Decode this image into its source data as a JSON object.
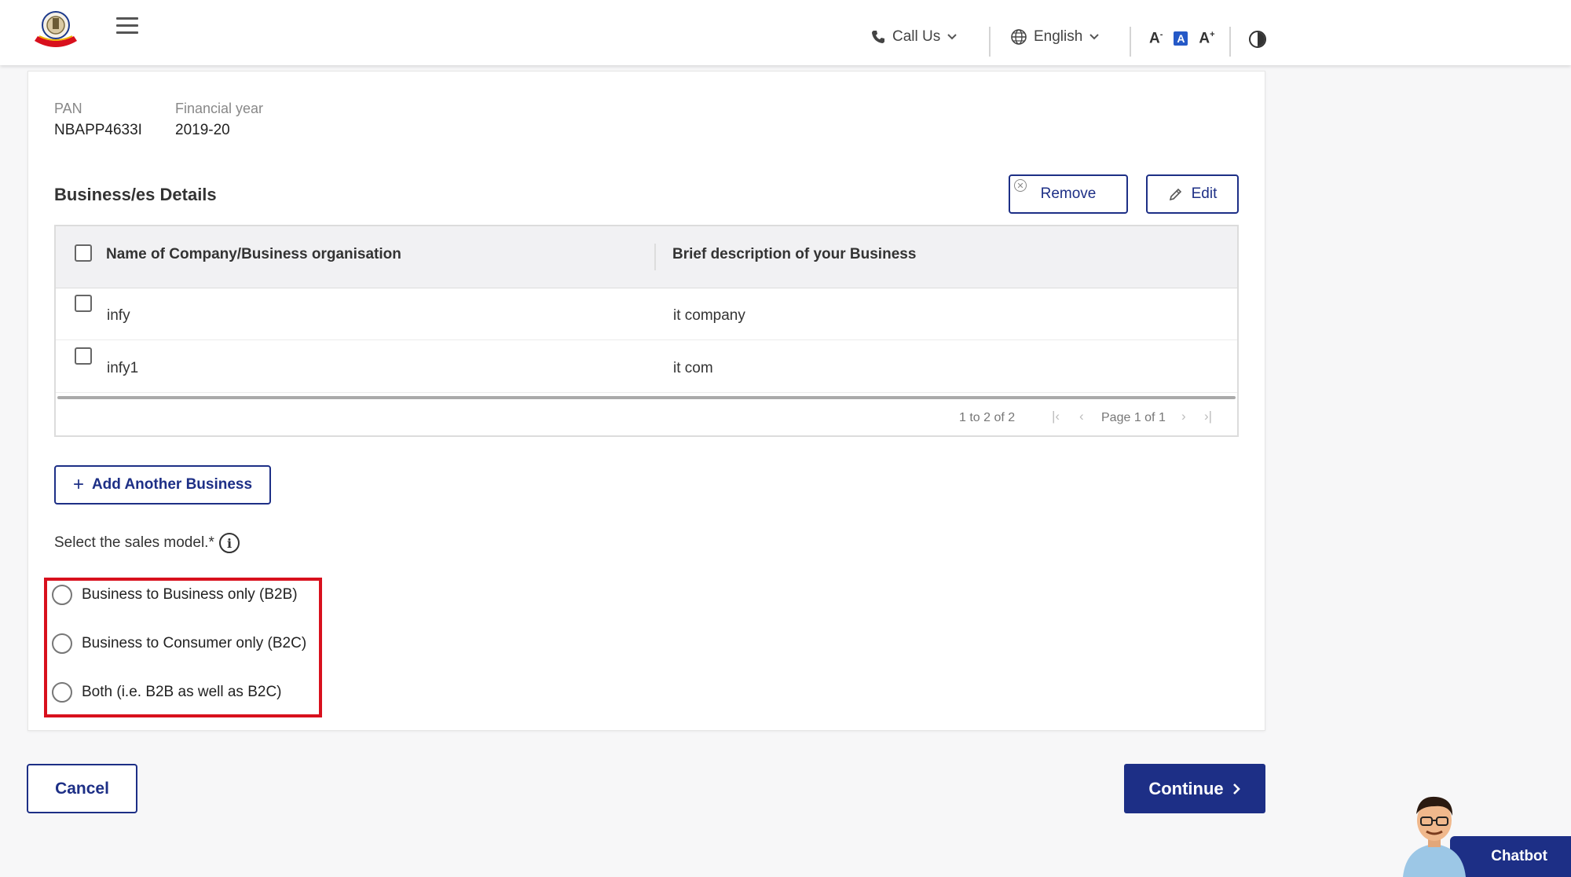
{
  "header": {
    "call_us": "Call Us",
    "language": "English",
    "font_decrease": "A",
    "font_normal": "A",
    "font_increase": "A",
    "icons": [
      "emblem-logo",
      "hamburger-icon",
      "phone-icon",
      "globe-icon",
      "chevron-down-icon",
      "contrast-icon"
    ]
  },
  "info": {
    "pan_label": "PAN",
    "pan_value": "NBAPP4633I",
    "fy_label": "Financial year",
    "fy_value": "2019-20"
  },
  "business": {
    "title": "Business/es Details",
    "remove_label": "Remove",
    "edit_label": "Edit",
    "columns": [
      "Name of Company/Business organisation",
      "Brief description of your Business"
    ],
    "rows": [
      {
        "name": "infy",
        "description": "it company"
      },
      {
        "name": "infy1",
        "description": "it com"
      }
    ],
    "range_text": "1 to 2 of 2",
    "page_text": "Page 1 of 1",
    "add_label": "Add Another Business"
  },
  "sales_model": {
    "label": "Select the sales model.*",
    "info_glyph": "i",
    "options": [
      "Business to Business only (B2B)",
      "Business to Consumer only (B2C)",
      "Both (i.e. B2B as well as B2C)"
    ]
  },
  "footer": {
    "cancel_label": "Cancel",
    "continue_label": "Continue",
    "chatbot_label": "Chatbot"
  },
  "colors": {
    "primary": "#1d2f86",
    "highlight": "#d8101d",
    "accent_blue": "#2559c7"
  }
}
